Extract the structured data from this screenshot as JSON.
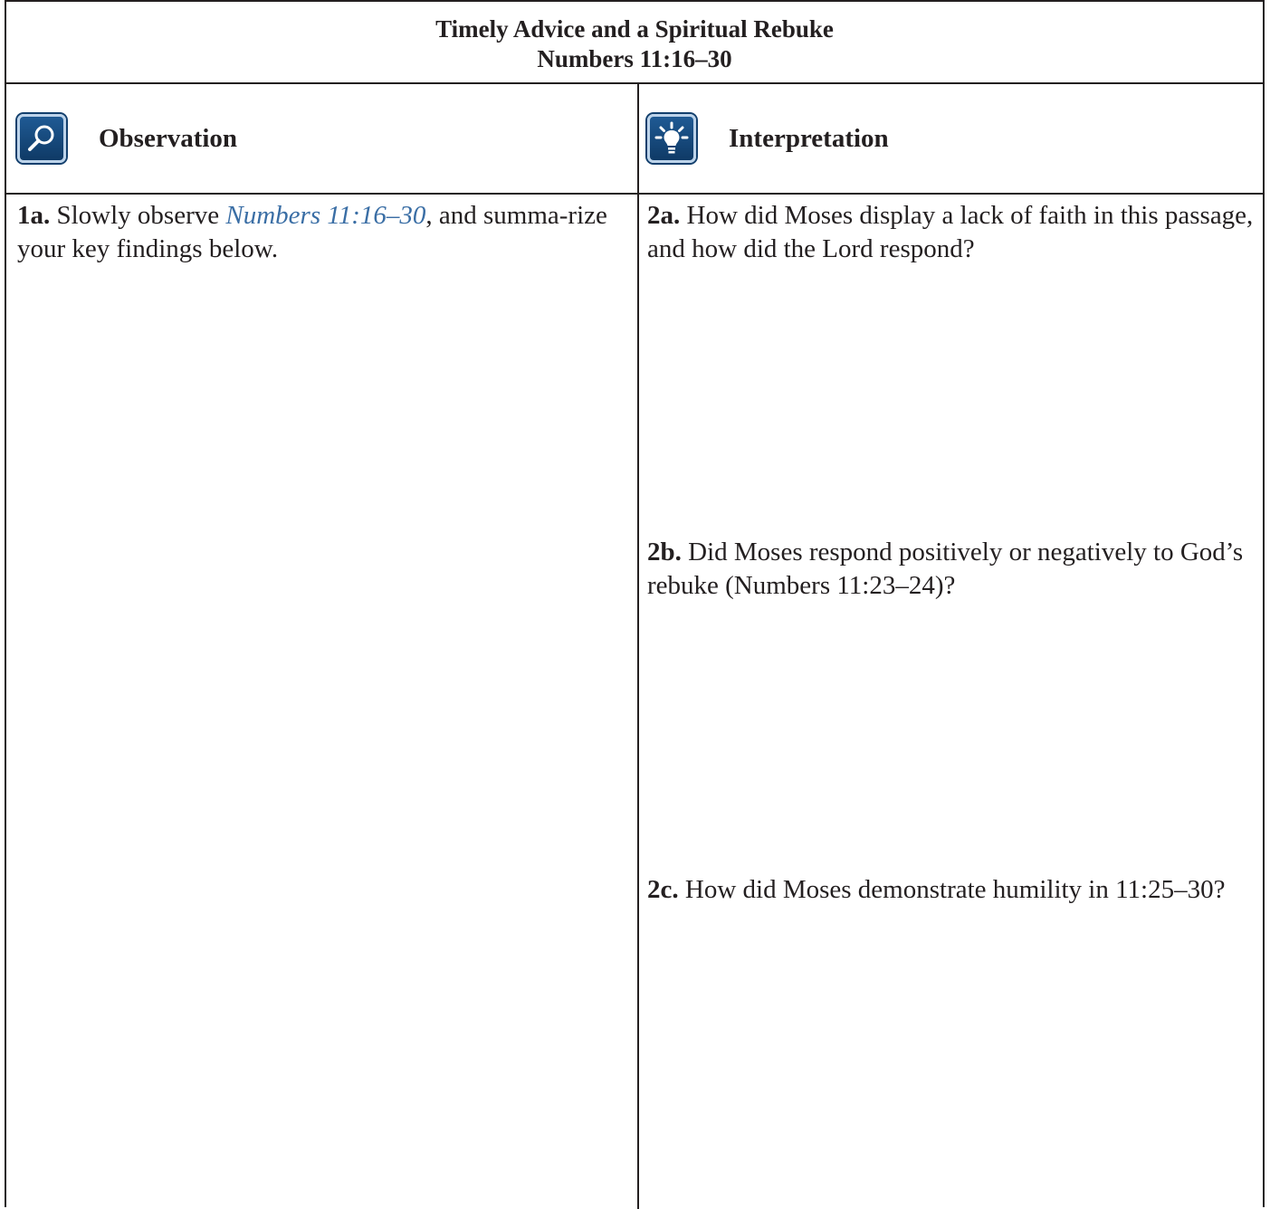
{
  "header": {
    "title": "Timely Advice and a Spiritual Rebuke",
    "subtitle": "Numbers 11:16–30"
  },
  "columns": {
    "observation": {
      "label": "Observation",
      "icon": "magnifier-icon"
    },
    "interpretation": {
      "label": "Interpretation",
      "icon": "lightbulb-icon"
    }
  },
  "questions": {
    "q1a": {
      "number": "1a.",
      "text_before": " Slowly observe ",
      "reference": "Numbers 11:16–30",
      "text_after": ", and summa-rize your key findings below."
    },
    "q2a": {
      "number": "2a.",
      "text": " How did Moses display a lack of faith in this passage, and how did the Lord respond?"
    },
    "q2b": {
      "number": "2b.",
      "text": " Did Moses respond positively or negatively to God’s rebuke (Numbers 11:23–24)?"
    },
    "q2c": {
      "number": "2c.",
      "text": " How did Moses demonstrate humility in 11:25–30?"
    }
  },
  "colors": {
    "icon_blue": "#1f5a94",
    "reference_blue": "#3a6ea5",
    "border": "#231f20"
  }
}
